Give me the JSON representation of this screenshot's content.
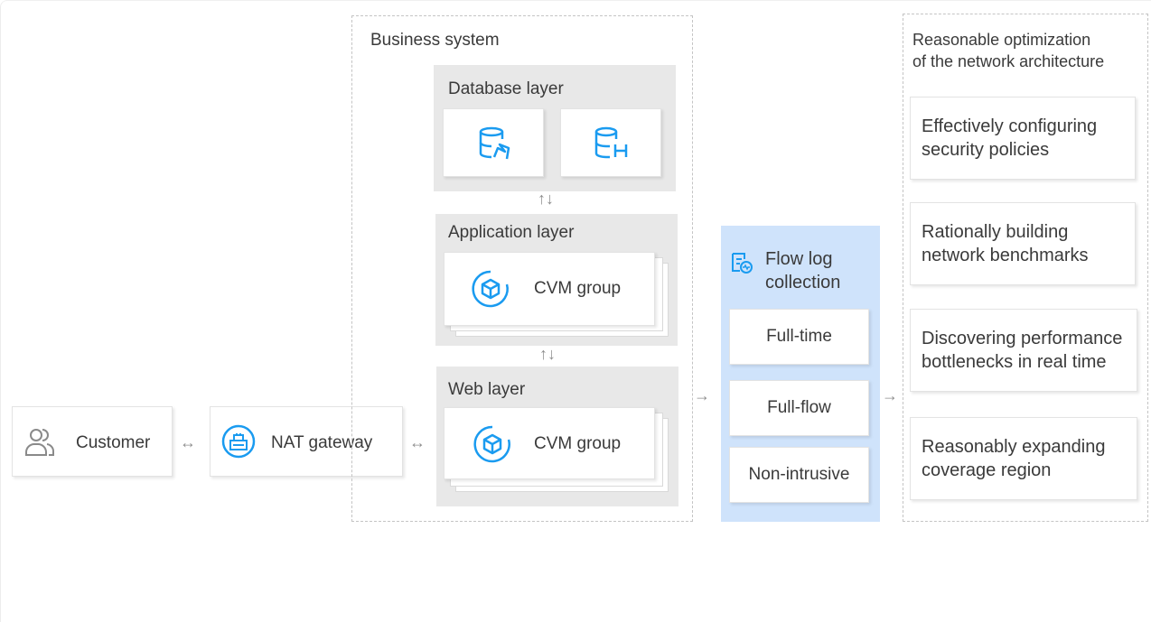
{
  "customer": {
    "label": "Customer",
    "icon": "users-icon"
  },
  "nat": {
    "label": "NAT gateway",
    "icon": "nat-gateway-icon"
  },
  "business": {
    "title": "Business system",
    "database": {
      "title": "Database layer",
      "icons": [
        "mysql-database-icon",
        "hbase-database-icon"
      ]
    },
    "application": {
      "title": "Application layer",
      "group_label": "CVM group",
      "icon": "cvm-icon"
    },
    "web": {
      "title": "Web layer",
      "group_label": "CVM group",
      "icon": "cvm-icon"
    }
  },
  "flowlog": {
    "title_line1": "Flow log",
    "title_line2": "collection",
    "icon": "flow-log-icon",
    "items": [
      "Full-time",
      "Full-flow",
      "Non-intrusive"
    ]
  },
  "optimization": {
    "title_line1": "Reasonable optimization",
    "title_line2": "of the network architecture",
    "items": [
      {
        "line1": "Effectively configuring",
        "line2": "security policies"
      },
      {
        "line1": "Rationally building",
        "line2": "network benchmarks"
      },
      {
        "line1": "Discovering performance",
        "line2": "bottlenecks in real time"
      },
      {
        "line1": "Reasonably expanding",
        "line2": "coverage region"
      }
    ]
  },
  "colors": {
    "accent": "#1a9bf0",
    "flow_bg": "#cfe3fb",
    "layer_bg": "#e8e8e8",
    "dashed": "#c4c4c4"
  }
}
